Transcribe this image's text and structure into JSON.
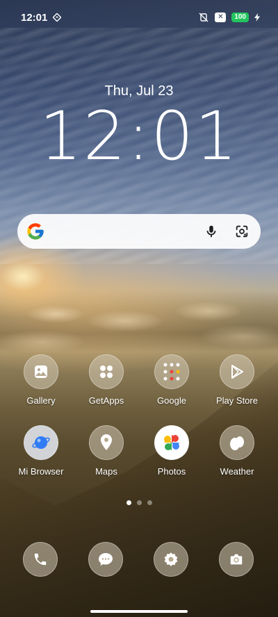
{
  "status_bar": {
    "time": "12:01",
    "battery": "100",
    "icons": [
      "navigation-diamond-icon",
      "mute-vibrate-icon",
      "x-badge-icon",
      "battery-icon",
      "charging-bolt-icon"
    ]
  },
  "lock_clock": {
    "date": "Thu, Jul 23",
    "time": "12:01"
  },
  "search_widget": {
    "icons": [
      "google-g-icon",
      "microphone-icon",
      "lens-camera-icon"
    ]
  },
  "apps": [
    {
      "label": "Gallery",
      "icon": "gallery-icon"
    },
    {
      "label": "GetApps",
      "icon": "getapps-icon"
    },
    {
      "label": "Google",
      "icon": "google-folder-icon"
    },
    {
      "label": "Play Store",
      "icon": "play-store-icon"
    },
    {
      "label": "Mi Browser",
      "icon": "mi-browser-icon"
    },
    {
      "label": "Maps",
      "icon": "maps-icon"
    },
    {
      "label": "Photos",
      "icon": "photos-icon"
    },
    {
      "label": "Weather",
      "icon": "weather-icon"
    }
  ],
  "page_indicator": {
    "pages": 3,
    "current": 1
  },
  "dock": [
    {
      "icon": "phone-icon"
    },
    {
      "icon": "messages-icon"
    },
    {
      "icon": "settings-icon"
    },
    {
      "icon": "camera-icon"
    }
  ],
  "colors": {
    "battery": "#22c55e",
    "search_bg": "#ffffff",
    "icon_tint": "#d2c8b4"
  }
}
